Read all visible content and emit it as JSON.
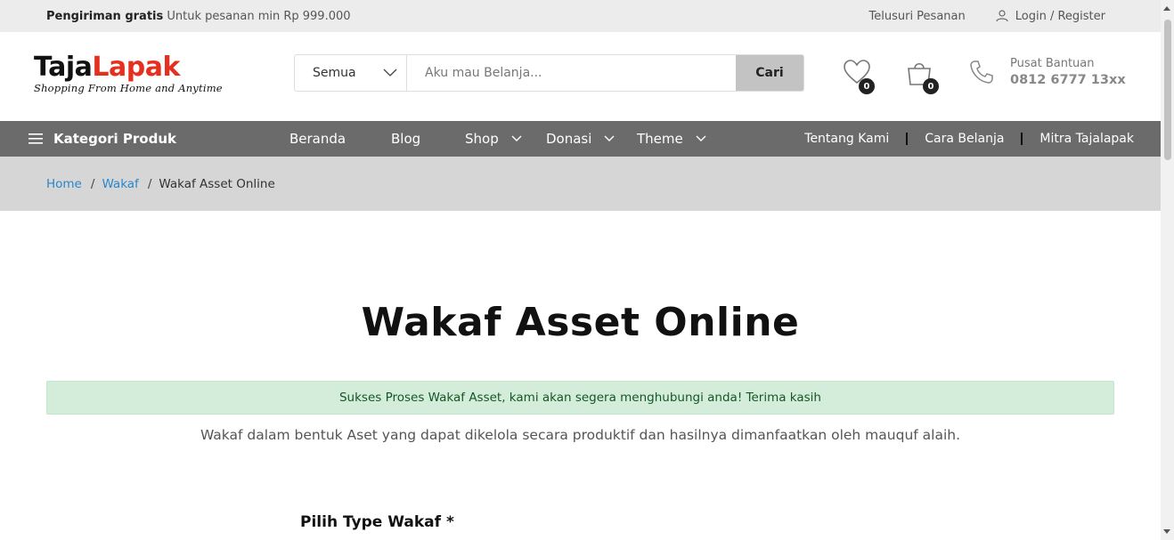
{
  "topbar": {
    "shipping_bold": "Pengiriman gratis",
    "shipping_text": "Untuk pesanan min Rp 999.000",
    "track_orders": "Telusuri Pesanan",
    "login_register": "Login / Register"
  },
  "header": {
    "logo_part1": "Taja",
    "logo_part2": "Lapak",
    "logo_tagline": "Shopping From Home and Anytime",
    "search_category": "Semua",
    "search_placeholder": "Aku mau Belanja...",
    "search_button": "Cari",
    "wishlist_count": "0",
    "cart_count": "0",
    "help_label": "Pusat Bantuan",
    "help_phone": "0812 6777 13xx"
  },
  "nav": {
    "categories": "Kategori Produk",
    "items": [
      {
        "label": "Beranda"
      },
      {
        "label": "Blog"
      },
      {
        "label": "Shop"
      },
      {
        "label": "Donasi"
      },
      {
        "label": "Theme"
      }
    ],
    "right_links": [
      {
        "label": "Tentang Kami"
      },
      {
        "label": "Cara Belanja"
      },
      {
        "label": "Mitra Tajalapak"
      }
    ]
  },
  "breadcrumb": {
    "home": "Home",
    "wakaf": "Wakaf",
    "current": "Wakaf Asset Online"
  },
  "content": {
    "title": "Wakaf Asset Online",
    "alert": "Sukses Proses Wakaf Asset, kami akan segera menghubungi anda! Terima kasih",
    "description": "Wakaf dalam bentuk Aset yang dapat dikelola secara produktif dan hasilnya dimanfaatkan oleh mauquf alaih.",
    "field_label": "Pilih Type Wakaf *"
  },
  "colors": {
    "logo_accent": "#e53020",
    "nav_bg": "#6b6b6b",
    "breadcrumb_bg": "#d6d6d6",
    "link": "#2b86c9",
    "alert_bg": "#d4edda",
    "alert_text": "#155724"
  }
}
